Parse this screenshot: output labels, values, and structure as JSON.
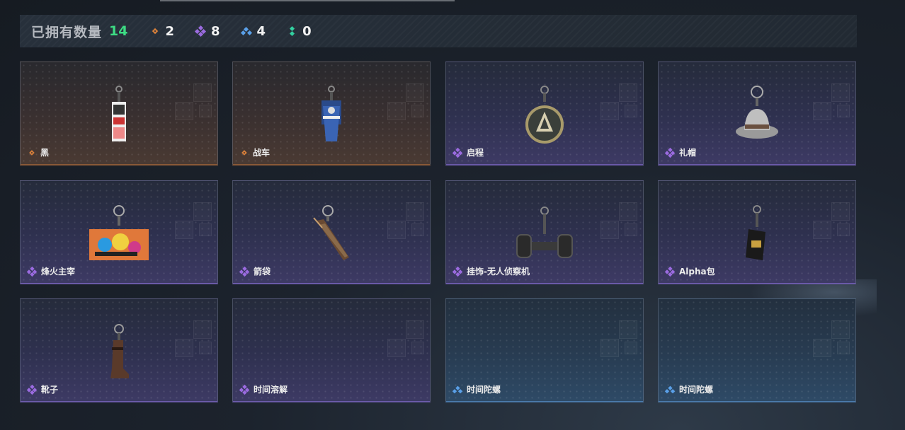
{
  "header": {
    "title": "已拥有数量",
    "total": "14",
    "stats": [
      {
        "rarity": "orange",
        "count": "2"
      },
      {
        "rarity": "purple",
        "count": "8"
      },
      {
        "rarity": "blue",
        "count": "4"
      },
      {
        "rarity": "green",
        "count": "0"
      }
    ]
  },
  "colors": {
    "orange": "#d9803a",
    "purple": "#9b6be0",
    "blue": "#5aa0e8",
    "green": "#33d0a0",
    "total_green": "#3ddc84"
  },
  "items": [
    {
      "name": "黑",
      "rarity": "orange",
      "icon": "poster-tag-charm-icon"
    },
    {
      "name": "战车",
      "rarity": "orange",
      "icon": "banner-figure-charm-icon"
    },
    {
      "name": "启程",
      "rarity": "purple",
      "icon": "medallion-charm-icon"
    },
    {
      "name": "礼帽",
      "rarity": "purple",
      "icon": "fedora-hat-charm-icon"
    },
    {
      "name": "烽火主宰",
      "rarity": "purple",
      "icon": "graffiti-container-charm-icon"
    },
    {
      "name": "箭袋",
      "rarity": "purple",
      "icon": "quiver-charm-icon"
    },
    {
      "name": "挂饰-无人侦察机",
      "rarity": "purple",
      "icon": "drone-wheel-charm-icon"
    },
    {
      "name": "Alpha包",
      "rarity": "purple",
      "icon": "alpha-pack-charm-icon"
    },
    {
      "name": "靴子",
      "rarity": "purple",
      "icon": "boot-charm-icon"
    },
    {
      "name": "时间溶解",
      "rarity": "purple",
      "icon": ""
    },
    {
      "name": "时间陀螺",
      "rarity": "blue",
      "icon": ""
    },
    {
      "name": "时间陀螺",
      "rarity": "blue",
      "icon": ""
    }
  ]
}
